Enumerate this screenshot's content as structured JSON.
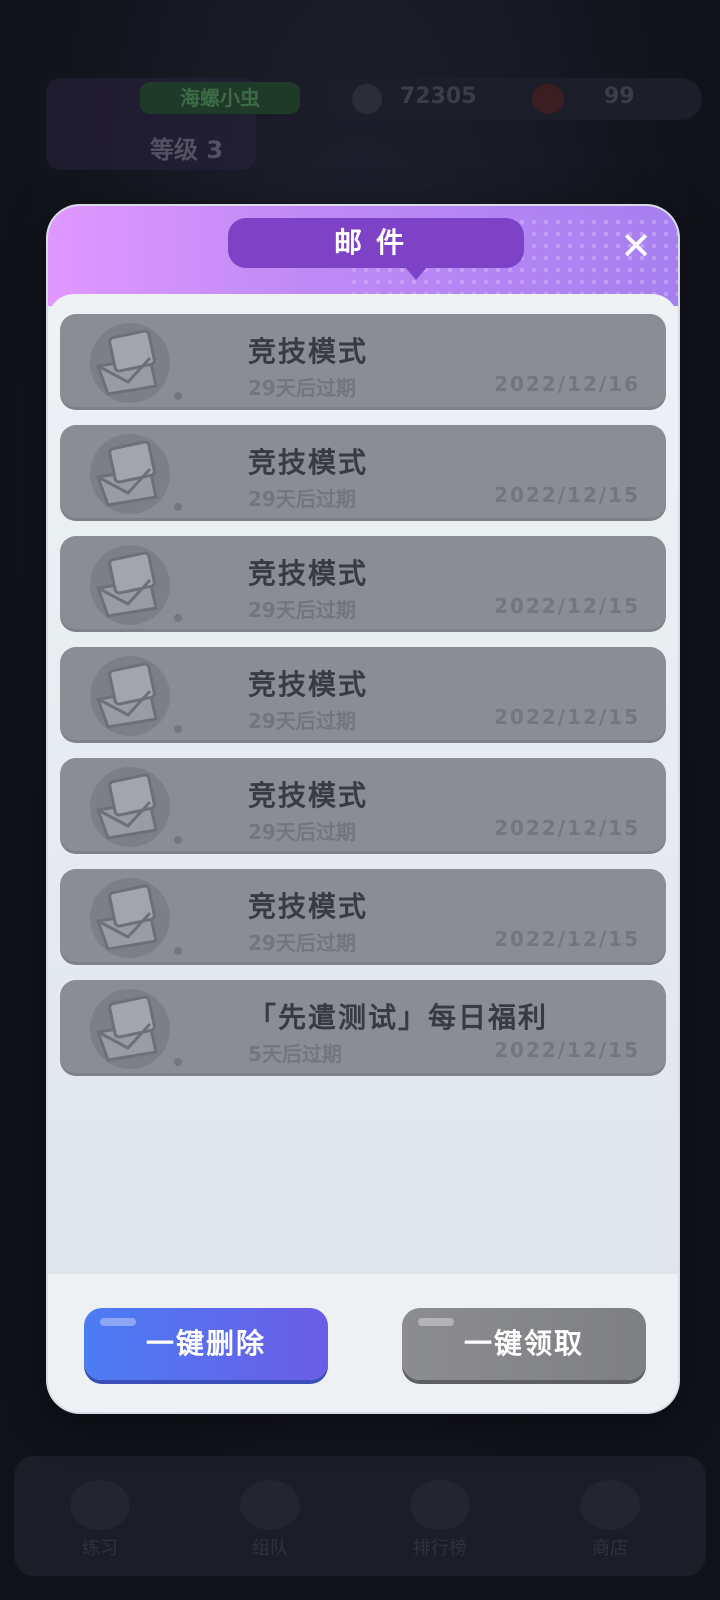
{
  "background": {
    "nickname": "海螺小虫",
    "level": "等级 3",
    "coins": "72305",
    "hearts": "99",
    "nav": [
      "练习",
      "组队",
      "排行榜",
      "商店"
    ]
  },
  "modal": {
    "title": "邮件",
    "close_icon": "close-icon",
    "mails": [
      {
        "title": "竞技模式",
        "expire": "29天后过期",
        "date": "2022/12/16"
      },
      {
        "title": "竞技模式",
        "expire": "29天后过期",
        "date": "2022/12/15"
      },
      {
        "title": "竞技模式",
        "expire": "29天后过期",
        "date": "2022/12/15"
      },
      {
        "title": "竞技模式",
        "expire": "29天后过期",
        "date": "2022/12/15"
      },
      {
        "title": "竞技模式",
        "expire": "29天后过期",
        "date": "2022/12/15"
      },
      {
        "title": "竞技模式",
        "expire": "29天后过期",
        "date": "2022/12/15"
      },
      {
        "title": "「先遣测试」每日福利",
        "expire": "5天后过期",
        "date": "2022/12/15"
      }
    ],
    "delete_all_label": "一键删除",
    "claim_all_label": "一键领取"
  },
  "colors": {
    "header_gradient_start": "#e098ff",
    "header_gradient_end": "#a67ff0",
    "title_pill": "#7e42c6",
    "mail_item_read": "#8b8d94",
    "delete_button": "#4b7df3",
    "claim_button_disabled": "#8c8d90"
  }
}
